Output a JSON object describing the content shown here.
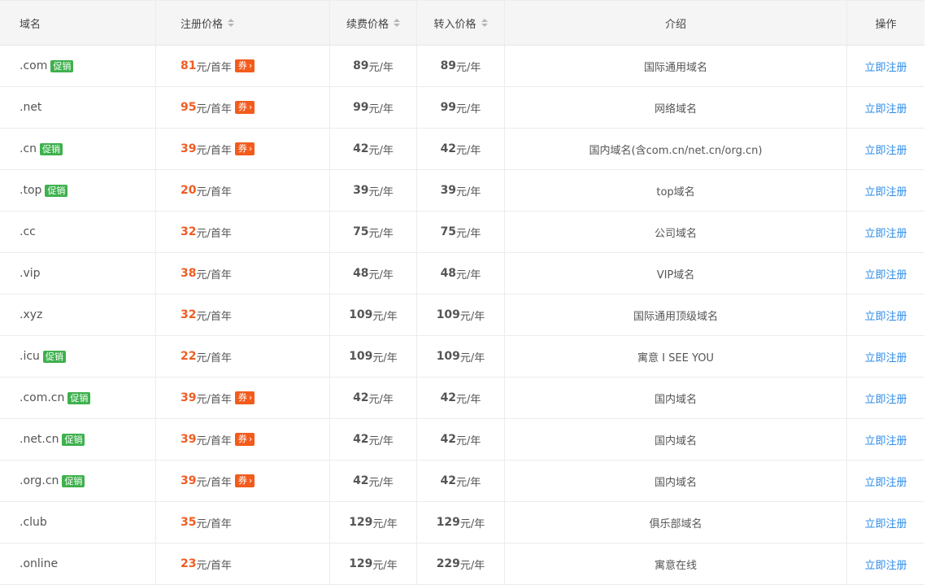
{
  "columns": {
    "domain": "域名",
    "register_price": "注册价格",
    "renew_price": "续费价格",
    "transfer_price": "转入价格",
    "intro": "介绍",
    "action": "操作"
  },
  "labels": {
    "promo": "促销",
    "coupon": "券",
    "coupon_arrow": "›",
    "first_year_unit": "元/首年",
    "year_unit": "元/年",
    "action_link": "立即注册"
  },
  "rows": [
    {
      "domain": ".com",
      "promo": true,
      "reg": "81",
      "coupon": true,
      "renew": "89",
      "transfer": "89",
      "intro": "国际通用域名"
    },
    {
      "domain": ".net",
      "promo": false,
      "reg": "95",
      "coupon": true,
      "renew": "99",
      "transfer": "99",
      "intro": "网络域名"
    },
    {
      "domain": ".cn",
      "promo": true,
      "reg": "39",
      "coupon": true,
      "renew": "42",
      "transfer": "42",
      "intro": "国内域名(含com.cn/net.cn/org.cn)"
    },
    {
      "domain": ".top",
      "promo": true,
      "reg": "20",
      "coupon": false,
      "renew": "39",
      "transfer": "39",
      "intro": "top域名"
    },
    {
      "domain": ".cc",
      "promo": false,
      "reg": "32",
      "coupon": false,
      "renew": "75",
      "transfer": "75",
      "intro": "公司域名"
    },
    {
      "domain": ".vip",
      "promo": false,
      "reg": "38",
      "coupon": false,
      "renew": "48",
      "transfer": "48",
      "intro": "VIP域名"
    },
    {
      "domain": ".xyz",
      "promo": false,
      "reg": "32",
      "coupon": false,
      "renew": "109",
      "transfer": "109",
      "intro": "国际通用顶级域名"
    },
    {
      "domain": ".icu",
      "promo": true,
      "reg": "22",
      "coupon": false,
      "renew": "109",
      "transfer": "109",
      "intro": "寓意 I SEE YOU"
    },
    {
      "domain": ".com.cn",
      "promo": true,
      "reg": "39",
      "coupon": true,
      "renew": "42",
      "transfer": "42",
      "intro": "国内域名"
    },
    {
      "domain": ".net.cn",
      "promo": true,
      "reg": "39",
      "coupon": true,
      "renew": "42",
      "transfer": "42",
      "intro": "国内域名"
    },
    {
      "domain": ".org.cn",
      "promo": true,
      "reg": "39",
      "coupon": true,
      "renew": "42",
      "transfer": "42",
      "intro": "国内域名"
    },
    {
      "domain": ".club",
      "promo": false,
      "reg": "35",
      "coupon": false,
      "renew": "129",
      "transfer": "129",
      "intro": "俱乐部域名"
    },
    {
      "domain": ".online",
      "promo": false,
      "reg": "23",
      "coupon": false,
      "renew": "129",
      "transfer": "229",
      "intro": "寓意在线"
    }
  ],
  "colors": {
    "accent_price": "#ef5d24",
    "promo_badge": "#3eb14d",
    "coupon_badge": "#f35b1c",
    "link": "#2d8ce8",
    "header_bg": "#f5f5f5"
  }
}
